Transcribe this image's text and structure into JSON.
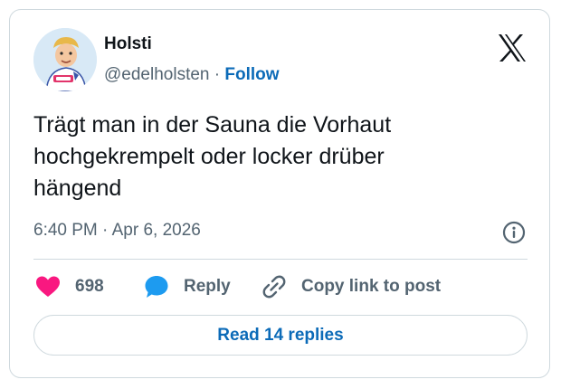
{
  "author": {
    "display_name": "Holsti",
    "handle": "@edelholsten",
    "separator": " · ",
    "follow_label": "Follow",
    "avatar_icon": "cartoon-avatar-icon"
  },
  "tweet": {
    "text_lines": [
      "Trägt man in der Sauna die Vorhaut",
      "hochgekrempelt oder locker drüber",
      "hängend"
    ],
    "timestamp": "6:40 PM · Apr 6, 2026"
  },
  "actions": {
    "like_count": "698",
    "reply_label": "Reply",
    "copy_link_label": "Copy link to post"
  },
  "read_replies_label": "Read 14 replies",
  "colors": {
    "text_primary": "#0f1419",
    "text_secondary": "#536471",
    "link_blue": "#0c6bb8",
    "heart_pink": "#f91880",
    "reply_blue": "#1d9bf0",
    "border": "#cfd9de"
  },
  "icons": [
    "x-logo-icon",
    "info-icon",
    "heart-icon",
    "reply-bubble-icon",
    "link-icon"
  ]
}
